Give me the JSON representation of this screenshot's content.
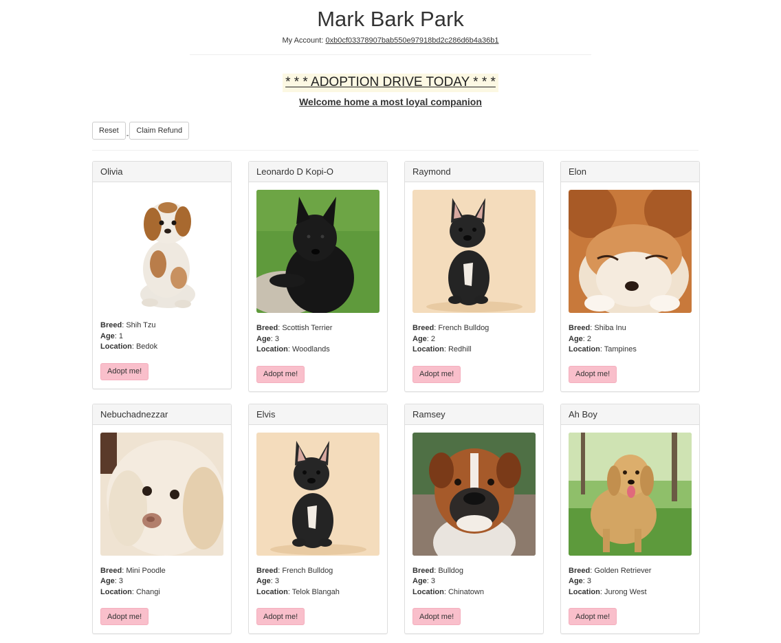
{
  "header": {
    "title": "Mark Bark Park",
    "account_label": "My Account:",
    "account_address": "0xb0cf03378907bab550e97918bd2c286d6b4a36b1"
  },
  "promo": {
    "banner": "* * * ADOPTION DRIVE TODAY * * *",
    "tagline": "Welcome home a most loyal companion"
  },
  "controls": {
    "reset_label": "Reset",
    "separator": "-",
    "refund_label": "Claim Refund"
  },
  "field_labels": {
    "breed": "Breed",
    "age": "Age",
    "location": "Location"
  },
  "adopt_label": "Adopt me!",
  "pets": [
    {
      "name": "Olivia",
      "breed": "Shih Tzu",
      "age": "1",
      "location": "Bedok"
    },
    {
      "name": "Leonardo D Kopi-O",
      "breed": "Scottish Terrier",
      "age": "3",
      "location": "Woodlands"
    },
    {
      "name": "Raymond",
      "breed": "French Bulldog",
      "age": "2",
      "location": "Redhill"
    },
    {
      "name": "Elon",
      "breed": "Shiba Inu",
      "age": "2",
      "location": "Tampines"
    },
    {
      "name": "Nebuchadnezzar",
      "breed": "Mini Poodle",
      "age": "3",
      "location": "Changi"
    },
    {
      "name": "Elvis",
      "breed": "French Bulldog",
      "age": "3",
      "location": "Telok Blangah"
    },
    {
      "name": "Ramsey",
      "breed": "Bulldog",
      "age": "3",
      "location": "Chinatown"
    },
    {
      "name": "Ah Boy",
      "breed": "Golden Retriever",
      "age": "3",
      "location": "Jurong West"
    }
  ]
}
